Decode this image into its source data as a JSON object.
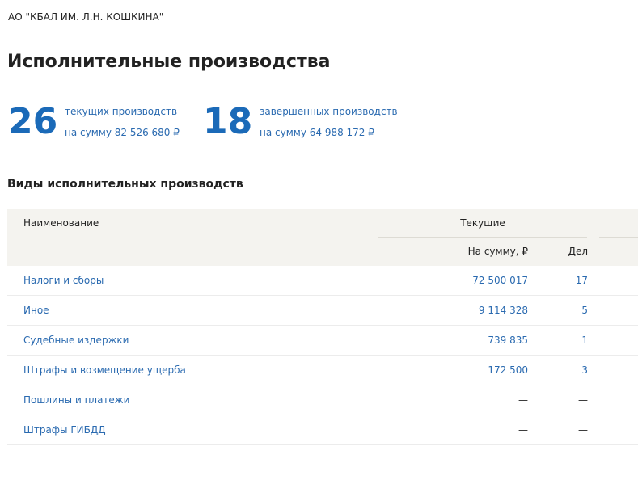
{
  "header": {
    "company": "АО \"КБАЛ ИМ. Л.Н. КОШКИНА\""
  },
  "page_title": "Исполнительные производства",
  "stats": {
    "current": {
      "count": "26",
      "label": "текущих производств",
      "sum": "на сумму 82 526 680 ₽"
    },
    "completed": {
      "count": "18",
      "label": "завершенных производств",
      "sum": "на сумму 64 988 172 ₽"
    }
  },
  "section_title": "Виды исполнительных производств",
  "table": {
    "col_name": "Наименование",
    "col_group": "Текущие",
    "col_sum": "На сумму, ₽",
    "col_count": "Дел",
    "rows": [
      {
        "name": "Налоги и сборы",
        "sum": "72 500 017",
        "count": "17"
      },
      {
        "name": "Иное",
        "sum": "9 114 328",
        "count": "5"
      },
      {
        "name": "Судебные издержки",
        "sum": "739 835",
        "count": "1"
      },
      {
        "name": "Штрафы и возмещение ущерба",
        "sum": "172 500",
        "count": "3"
      },
      {
        "name": "Пошлины и платежи",
        "sum": "—",
        "count": "—"
      },
      {
        "name": "Штрафы ГИБДД",
        "sum": "—",
        "count": "—"
      }
    ]
  },
  "colors": {
    "accent": "#1b6ab8",
    "link": "#2a6ab0",
    "table_header_bg": "#f4f3ef"
  }
}
